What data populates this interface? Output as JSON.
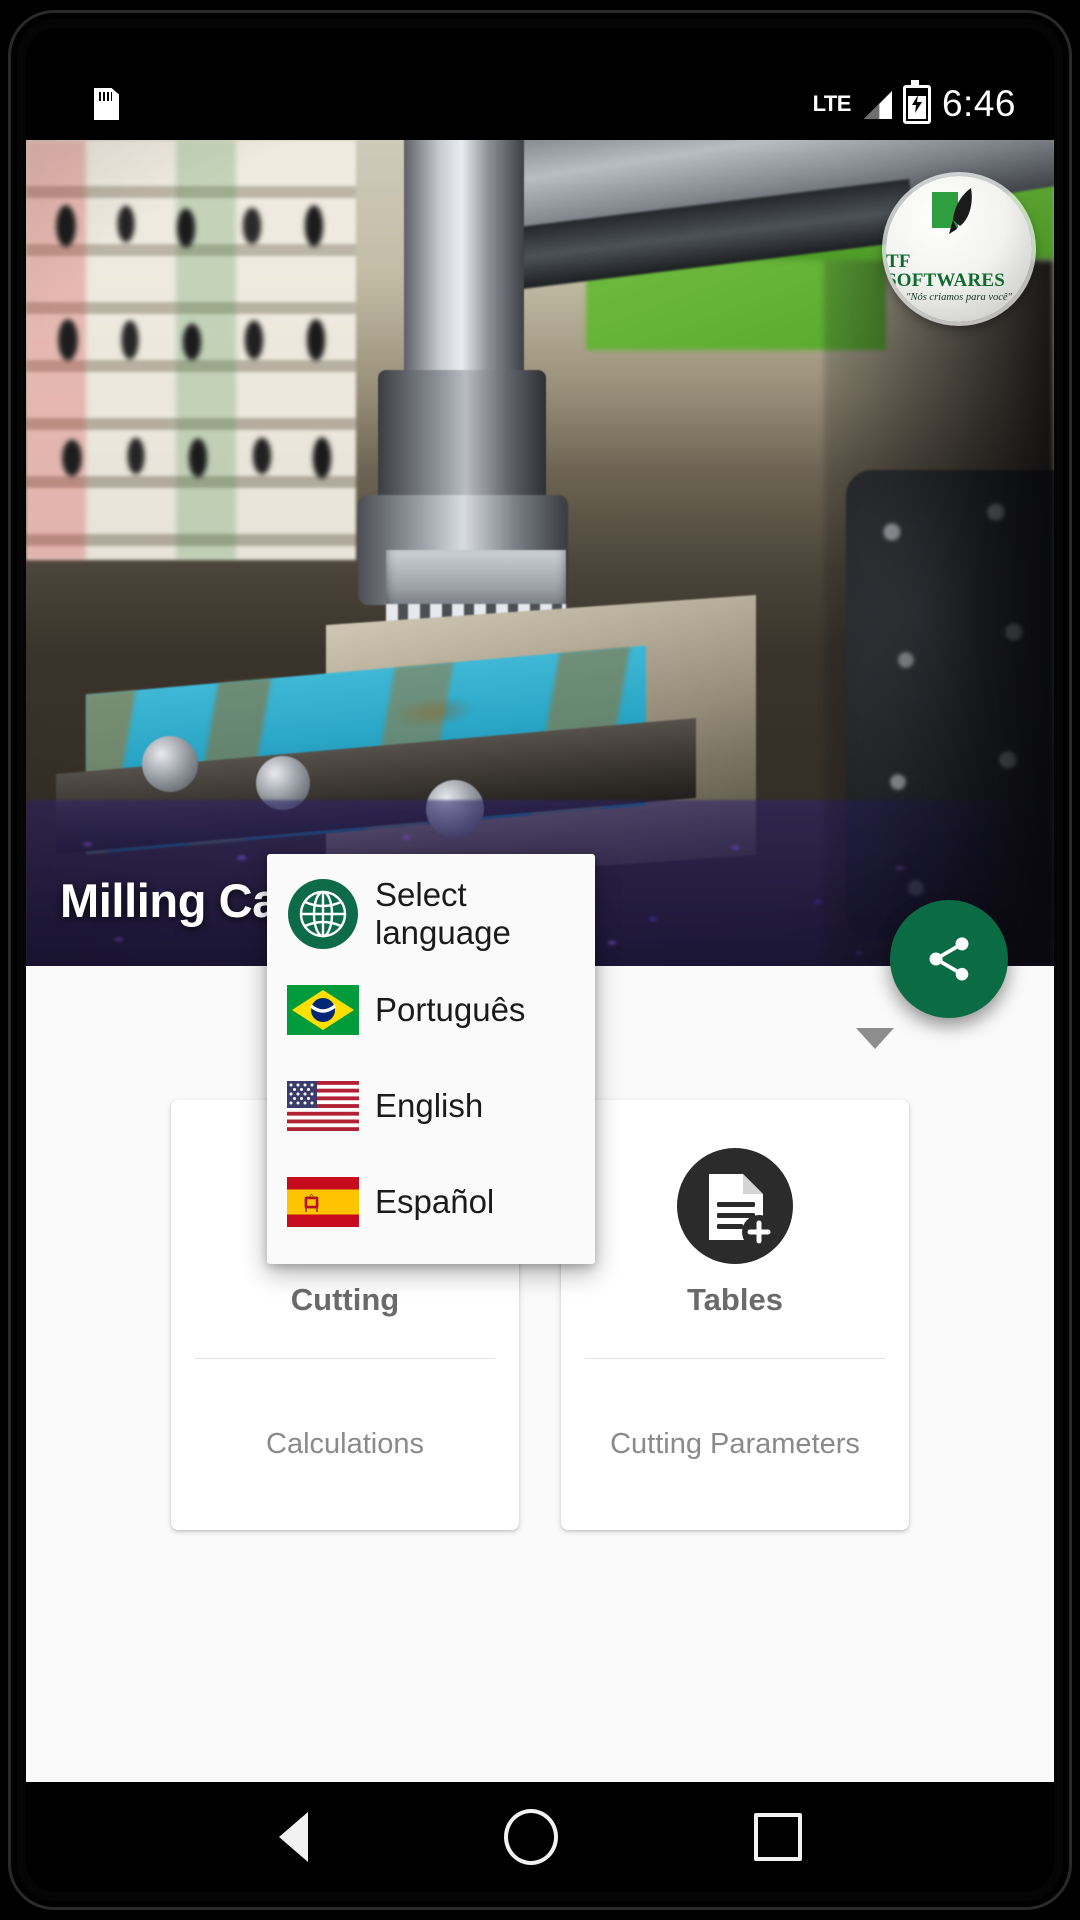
{
  "status_bar": {
    "sd_icon": "sd-card-icon",
    "network_label": "LTE",
    "signal_icon": "signal-bars-icon",
    "battery_icon": "battery-charging-icon",
    "time": "6:46"
  },
  "hero": {
    "title": "Milling Calculations",
    "image_alt": "milling-machine-photo",
    "logo": {
      "name": "TF SOFTWARES",
      "slogan": "\"Nós criamos para você\"",
      "icon": "quill-pen-icon"
    }
  },
  "share_button": {
    "icon": "share-icon",
    "color": "#0b6b45"
  },
  "language_selector": {
    "caret_icon": "chevron-down-icon",
    "selected": "Select language"
  },
  "language_popup": {
    "items": [
      {
        "label": "Select language",
        "icon": "globe-icon"
      },
      {
        "label": "Português",
        "icon": "flag-brazil-icon"
      },
      {
        "label": "English",
        "icon": "flag-usa-icon"
      },
      {
        "label": "Español",
        "icon": "flag-spain-icon"
      }
    ]
  },
  "cards": [
    {
      "title": "Cutting",
      "subtitle": "Calculations",
      "icon": "formula-calculations-icon"
    },
    {
      "title": "Tables",
      "subtitle": "Cutting Parameters",
      "icon": "document-add-icon"
    }
  ],
  "navigation_bar": {
    "back": "back-icon",
    "home": "home-icon",
    "recents": "recents-icon"
  }
}
